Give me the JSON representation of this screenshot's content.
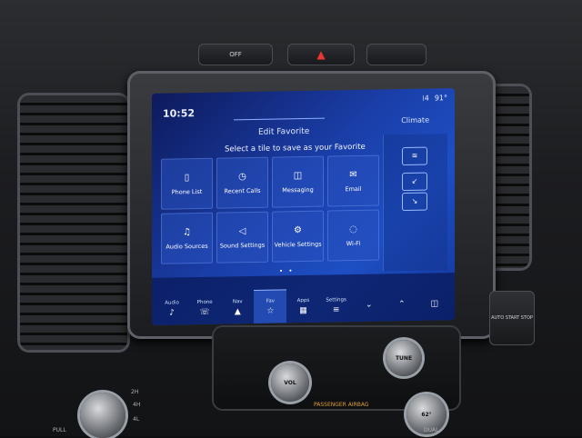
{
  "screen": {
    "clock": "10:52",
    "status_signal": "⁞4",
    "status_temp": "91°",
    "header_title": "Edit Favorite",
    "climate_label": "Climate",
    "prompt": "Select a tile to save as your Favorite",
    "tiles": [
      {
        "label": "Phone List",
        "icon": "phone-book-icon",
        "glyph": "▯"
      },
      {
        "label": "Recent Calls",
        "icon": "clock-icon",
        "glyph": "◷"
      },
      {
        "label": "Messaging",
        "icon": "chat-bubble-icon",
        "glyph": "◫"
      },
      {
        "label": "Email",
        "icon": "envelope-icon",
        "glyph": "✉"
      },
      {
        "label": "Audio Sources",
        "icon": "music-note-icon",
        "glyph": "♫"
      },
      {
        "label": "Sound Settings",
        "icon": "speaker-icon",
        "glyph": "◁"
      },
      {
        "label": "Vehicle Settings",
        "icon": "car-settings-icon",
        "glyph": "⚙"
      },
      {
        "label": "Wi-Fi",
        "icon": "wifi-icon",
        "glyph": "◌"
      }
    ],
    "nav": [
      {
        "label": "Audio",
        "glyph": "♪",
        "icon": "music-note-icon"
      },
      {
        "label": "Phone",
        "glyph": "☏",
        "icon": "phone-icon"
      },
      {
        "label": "Nav",
        "glyph": "▲",
        "icon": "navigation-icon"
      },
      {
        "label": "Fav",
        "glyph": "☆",
        "icon": "star-icon"
      },
      {
        "label": "Apps",
        "glyph": "▦",
        "icon": "apps-grid-icon"
      },
      {
        "label": "Settings",
        "glyph": "≡",
        "icon": "settings-sliders-icon"
      }
    ],
    "page_dots": "• •"
  },
  "dash": {
    "off_button": "OFF",
    "vol_label": "VOL",
    "tune_label": "TUNE",
    "airbag_label": "PASSENGER AIRBAG",
    "temp_display": "62°",
    "dual_label": "DUAL",
    "pull_label": "PULL",
    "drive_2h": "2H",
    "drive_4h": "4H",
    "drive_4l": "4L",
    "btn_auto_start": "AUTO START STOP"
  }
}
